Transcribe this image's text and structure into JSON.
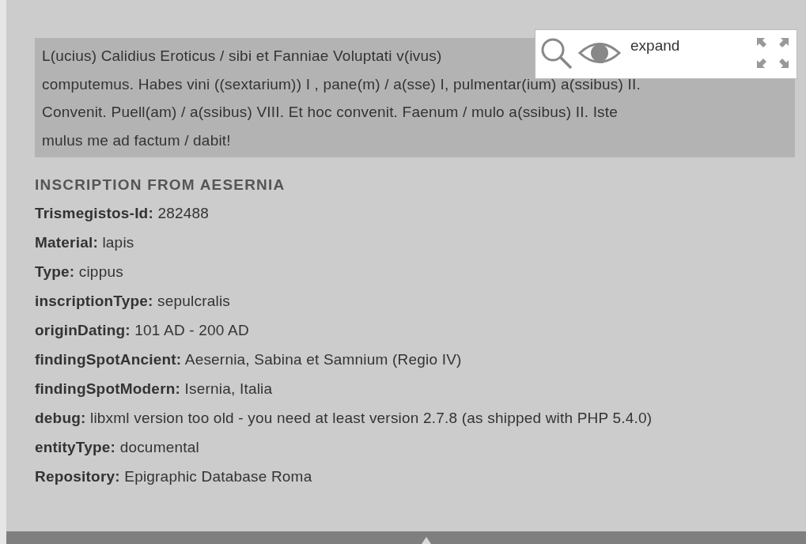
{
  "inscription_lines": [
    "L(ucius) Calidius Eroticus / sibi et Fanniae Voluptati v(ivus)",
    "computemus. Habes vini ((sextarium)) I , pane(m) / a(sse) I, pulmentar(ium) a(ssibus) II.",
    "Convenit. Puell(am) / a(ssibus) VIII. Et hoc convenit. Faenum / mulo a(ssibus) II. Iste",
    "mulus me ad factum / dabit!"
  ],
  "viewer_toolbar": {
    "expand_label": "expand"
  },
  "heading": "INSCRIPTION FROM AESERNIA",
  "fields": [
    {
      "label": "Trismegistos-Id:",
      "value": "282488"
    },
    {
      "label": "Material:",
      "value": "lapis"
    },
    {
      "label": "Type:",
      "value": "cippus"
    },
    {
      "label": "inscriptionType:",
      "value": "sepulcralis"
    },
    {
      "label": "originDating:",
      "value": "101 AD - 200 AD"
    },
    {
      "label": "findingSpotAncient:",
      "value": "Aesernia, Sabina et Samnium (Regio IV)"
    },
    {
      "label": "findingSpotModern:",
      "value": "Isernia, Italia"
    },
    {
      "label": "debug:",
      "value": "libxml version too old - you need at least version 2.7.8 (as shipped with PHP 5.4.0)"
    },
    {
      "label": "entityType:",
      "value": "documental"
    },
    {
      "label": "Repository:",
      "value": "Epigraphic Database Roma"
    }
  ]
}
